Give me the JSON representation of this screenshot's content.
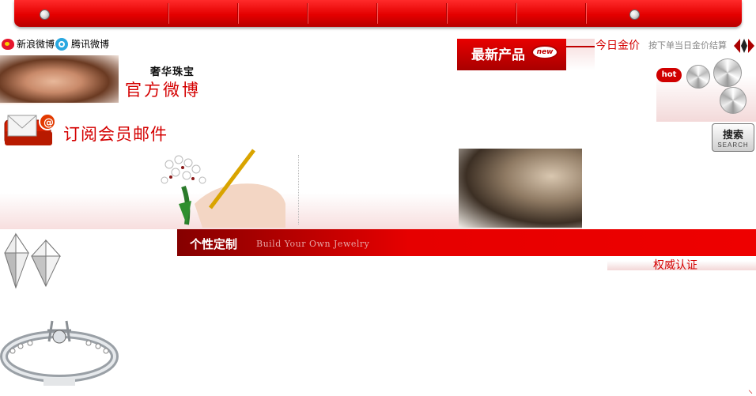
{
  "top_nav": {
    "separators": 8
  },
  "social": {
    "sina_label": "新浪微博",
    "tencent_label": "腾讯微博"
  },
  "official_weibo": {
    "brand_small": "奢华珠宝",
    "brand_big": "官方微博"
  },
  "subscribe": {
    "label": "订阅会员邮件"
  },
  "new_products": {
    "label": "最新产品",
    "badge": "new"
  },
  "gold": {
    "label": "今日金价",
    "hint": "按下单当日金价结算"
  },
  "hot": {
    "badge": "hot"
  },
  "search": {
    "label": "搜索",
    "sub": "SEARCH"
  },
  "custom": {
    "title": "个性定制",
    "subtitle": "Build Your Own Jewelry"
  },
  "authority": {
    "label": "权威认证"
  },
  "colors": {
    "accent": "#e00000",
    "dark_red": "#a80000",
    "text_red": "#d40000"
  }
}
